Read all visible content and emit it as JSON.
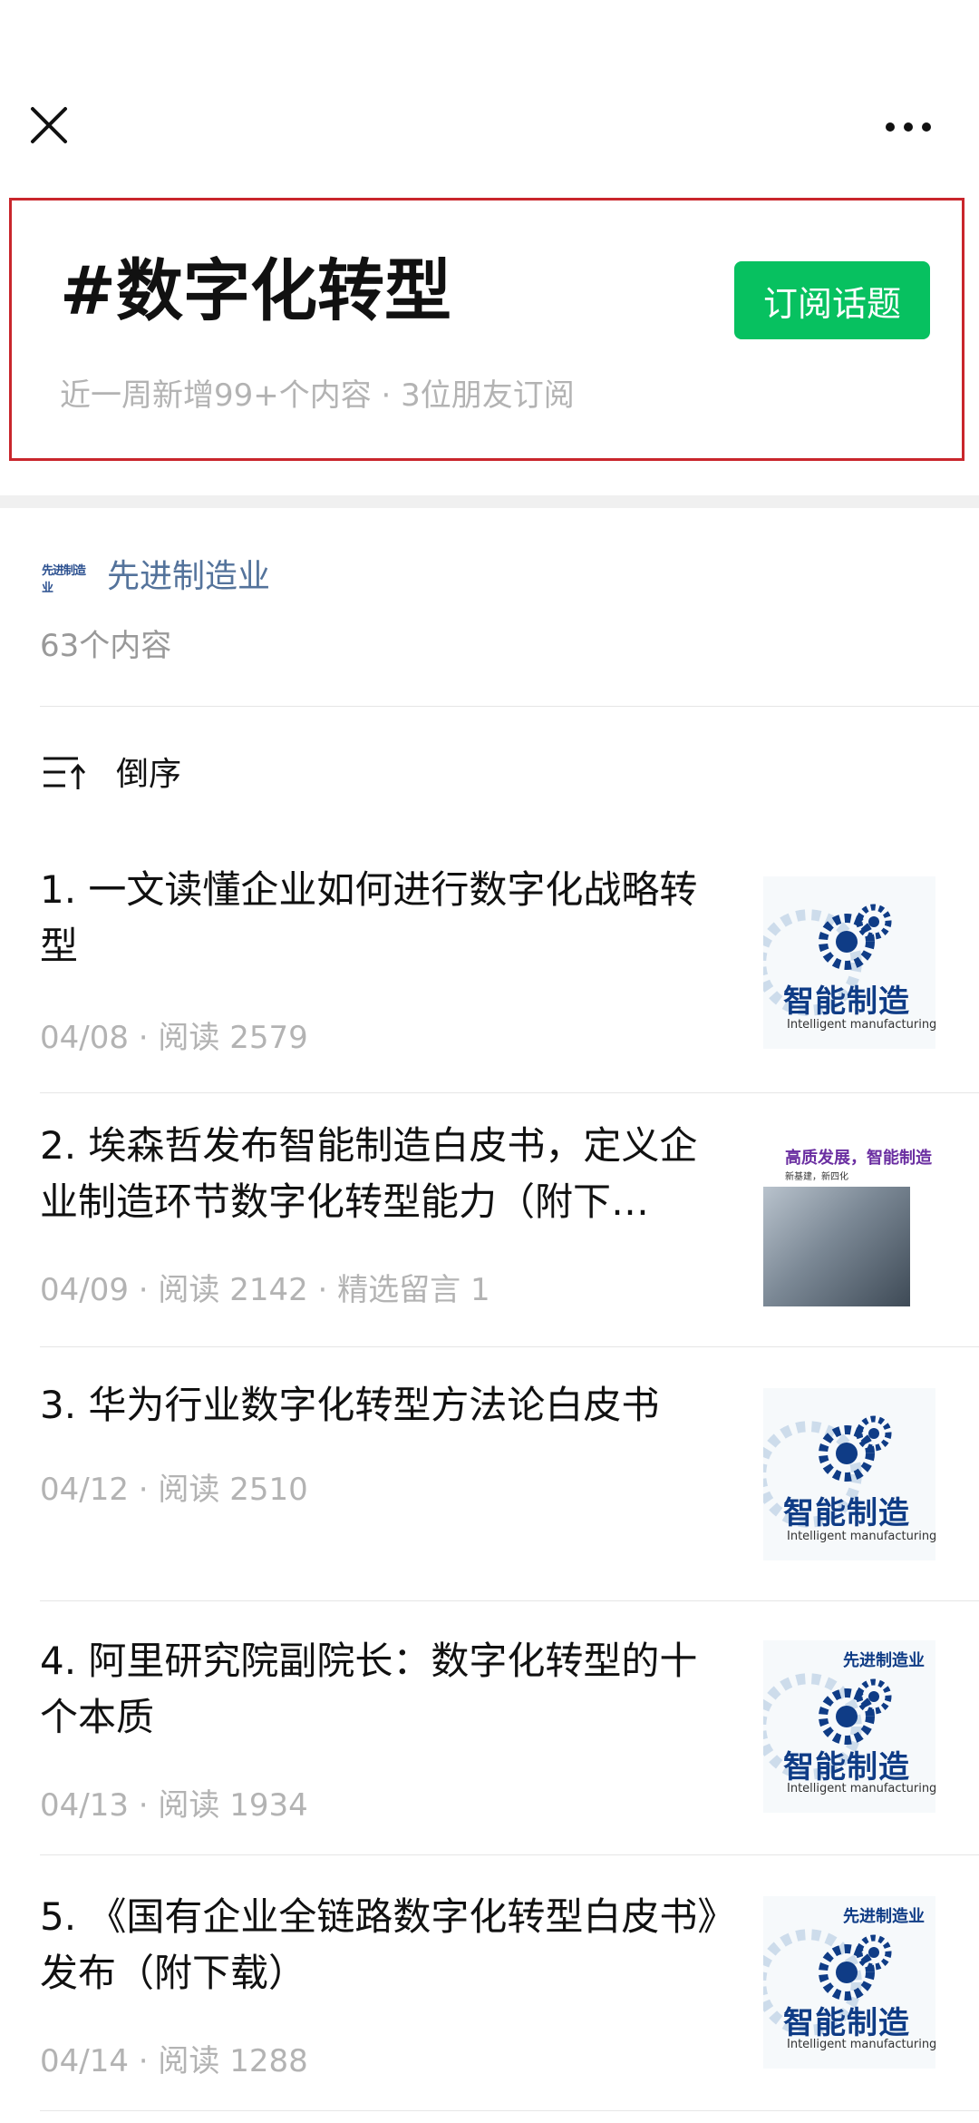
{
  "header": {
    "title": "#数字化转型",
    "subscribe_label": "订阅话题",
    "meta": "近一周新增99+个内容 · 3位朋友订阅",
    "accent_color": "#07c160",
    "highlight_color": "#c9262c"
  },
  "topbar": {
    "close_icon": "close-icon",
    "more_icon": "more-icon"
  },
  "source": {
    "logo_text": "先进制造业",
    "name": "先进制造业",
    "count": "63个内容"
  },
  "sort": {
    "label": "倒序",
    "icon": "sort-desc-icon"
  },
  "thumbnails": {
    "cn": "智能制造",
    "en": "Intelligent manufacturing",
    "brand": "先进制造业",
    "photo_title": "高质发展，智能制造",
    "photo_sub": "新基建，新四化"
  },
  "articles": [
    {
      "title": "1. 一文读懂企业如何进行数字化战略转型",
      "meta": "04/08 · 阅读 2579"
    },
    {
      "title": "2. 埃森哲发布智能制造白皮书，定义企业制造环节数字化转型能力（附下…",
      "meta": "04/09 · 阅读 2142 · 精选留言 1"
    },
    {
      "title": "3. 华为行业数字化转型方法论白皮书",
      "meta": "04/12 · 阅读 2510"
    },
    {
      "title": "4. 阿里研究院副院长：数字化转型的十个本质",
      "meta": "04/13 · 阅读 1934"
    },
    {
      "title": "5. 《国有企业全链路数字化转型白皮书》发布（附下载）",
      "meta": "04/14 · 阅读 1288"
    }
  ]
}
